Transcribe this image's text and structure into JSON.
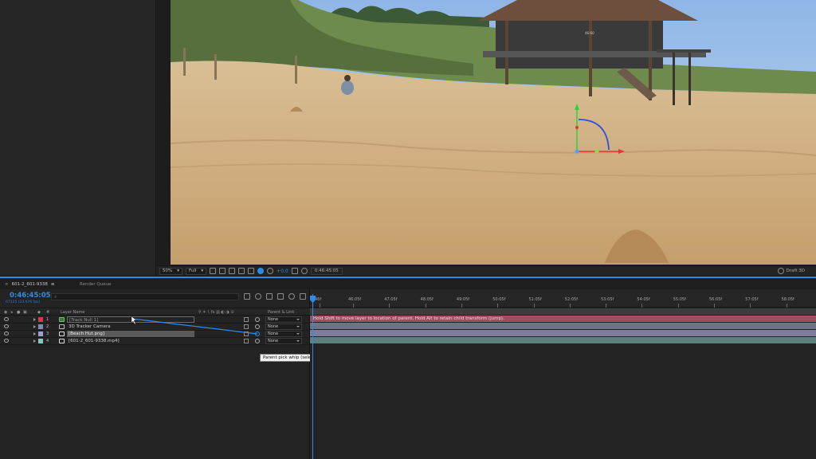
{
  "viewer": {
    "zoom": "50%",
    "resolution": "Full",
    "exposure": "+0.0",
    "timecode": "0:46:45:05",
    "renderer": "Draft 3D"
  },
  "scene": {
    "hut_sign": "46-60"
  },
  "timeline": {
    "tabs": [
      {
        "label": "601-2_601-9338",
        "menu": "≡"
      },
      {
        "label": "Render Queue"
      }
    ],
    "current_time": "0:46:45:05",
    "fps_info": "67125 (23.976 fps)",
    "search_placeholder": "",
    "columns": {
      "layer_name": "Layer Name",
      "parent": "Parent & Link",
      "number_symbol": "#"
    },
    "layers": [
      {
        "num": "1",
        "name": "[Track Null 1]",
        "label_color": "#d13b4b",
        "parent": "None",
        "type": "null"
      },
      {
        "num": "2",
        "name": "3D Tracker Camera",
        "label_color": "#7e8ab8",
        "parent": "None",
        "type": "camera"
      },
      {
        "num": "3",
        "name": "[Beach Hut.png]",
        "label_color": "#a09ed0",
        "parent": "None",
        "type": "image",
        "selected": true
      },
      {
        "num": "4",
        "name": "[601-2_601-9338.mp4]",
        "label_color": "#86c7bf",
        "parent": "None",
        "type": "video"
      }
    ],
    "ruler_ticks": [
      "46f",
      "46:05f",
      "47:05f",
      "48:05f",
      "49:05f",
      "50:05f",
      "51:05f",
      "52:05f",
      "53:05f",
      "54:05f",
      "55:05f",
      "56:05f",
      "57:05f",
      "58:05f"
    ],
    "status_message": "Hold Shift to move layer to location of parent. Hold Alt to retain child transform (jump).",
    "tooltip": "Parent pick whip (select layer from which to inherit transforms)"
  },
  "colors": {
    "accent": "#2d8ceb",
    "bar_null": "#9e5060",
    "bar_camera": "#6f7387",
    "bar_image": "#7d7c9e",
    "bar_video": "#5d807e"
  }
}
